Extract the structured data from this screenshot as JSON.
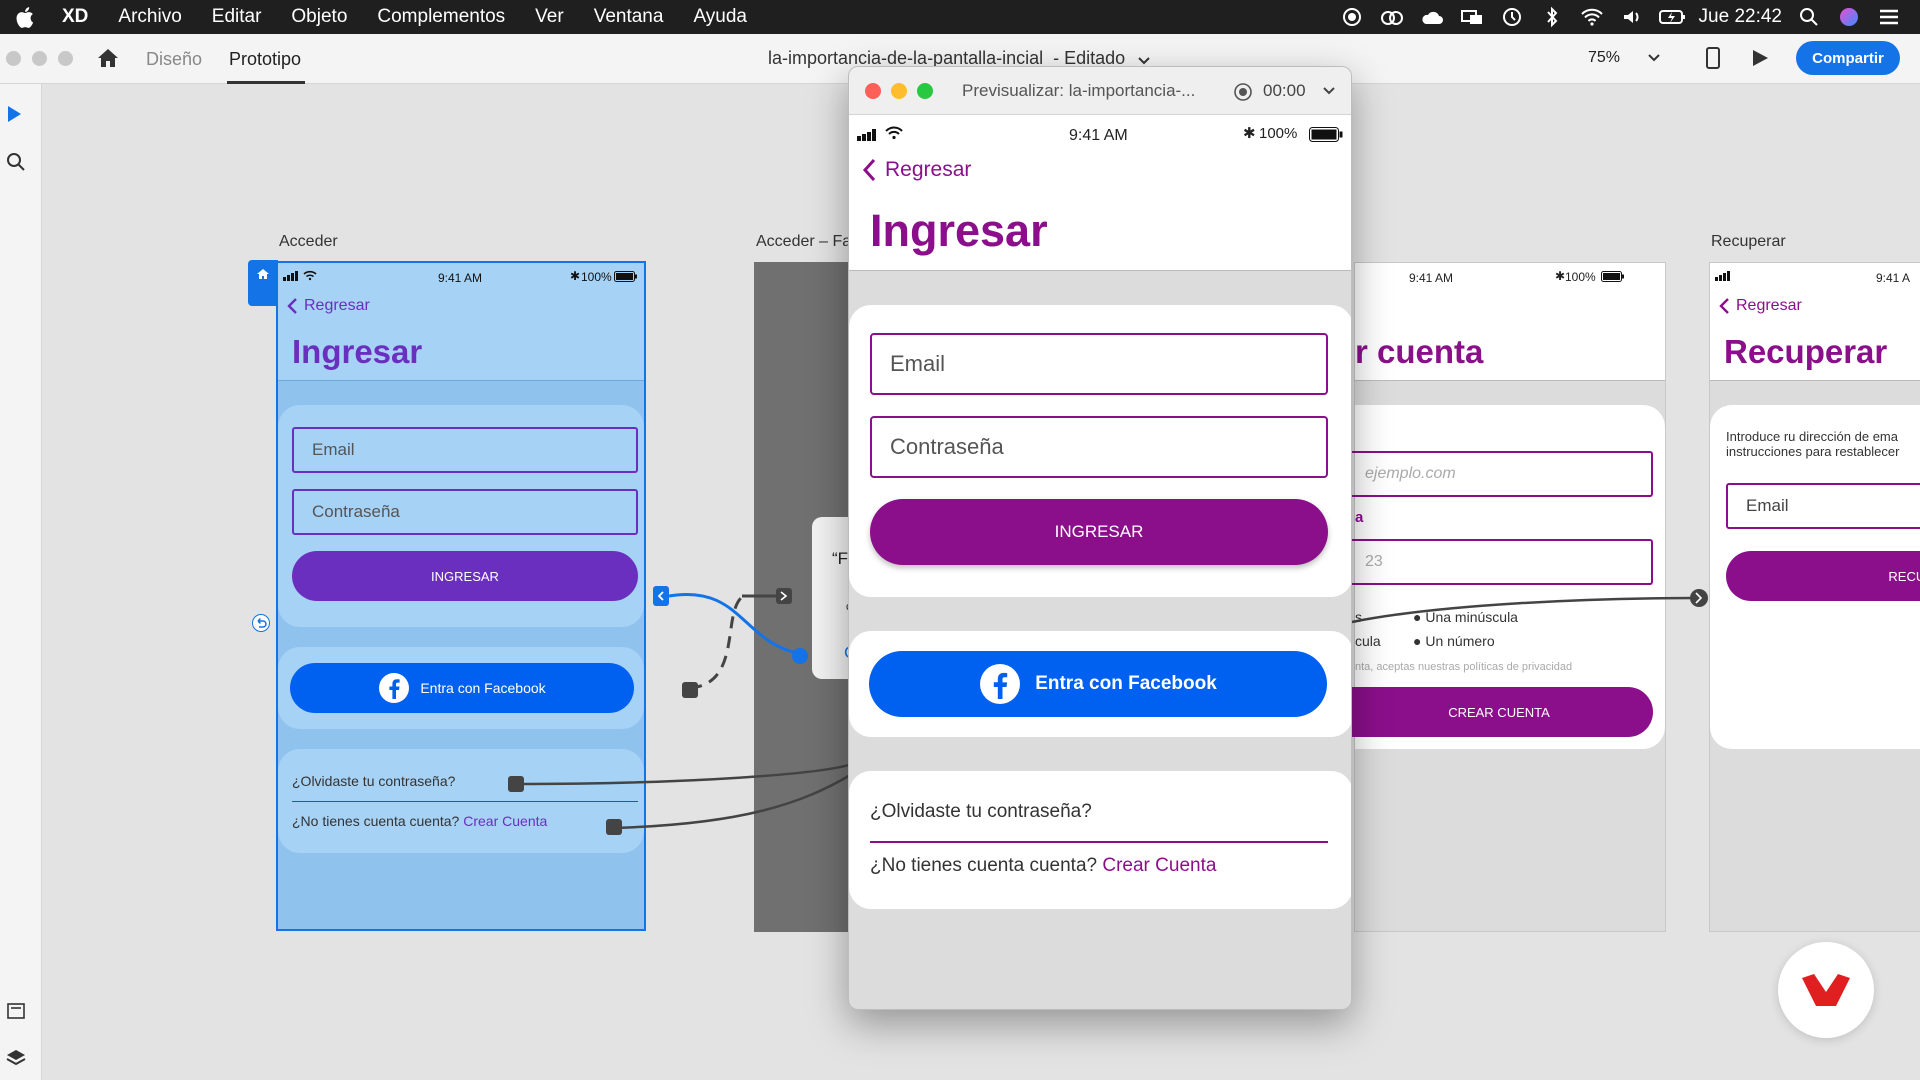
{
  "menubar": {
    "app": "XD",
    "items": [
      "Archivo",
      "Editar",
      "Objeto",
      "Complementos",
      "Ver",
      "Ventana",
      "Ayuda"
    ],
    "clock": "Jue 22:42"
  },
  "toolbar": {
    "tab_design": "Diseño",
    "tab_prototype": "Prototipo",
    "doc_title": "la-importancia-de-la-pantalla-incial",
    "doc_state": "- Editado",
    "zoom": "75%",
    "share": "Compartir"
  },
  "artboards": {
    "acceder": {
      "label": "Acceder",
      "time": "9:41 AM",
      "battery": "100%",
      "back": "Regresar",
      "title": "Ingresar",
      "email": "Email",
      "password": "Contraseña",
      "submit": "INGRESAR",
      "facebook": "Entra con Facebook",
      "forgot": "¿Olvidaste tu contraseña?",
      "noaccount": "¿No tienes cuenta cuenta?",
      "create": "Crear Cuenta"
    },
    "acceder_fb": {
      "label": "Acceder – Fa",
      "dialog_text": "“Fa",
      "dialog_small": "c",
      "dialog_link": "C"
    },
    "crear": {
      "time": "9:41 AM",
      "battery": "100%",
      "title_partial": "r cuenta",
      "email_ph": "ejemplo.com",
      "label_partial": "a",
      "pass_ph": "23",
      "rule1_partial": "s",
      "rule2": "Una minúscula",
      "rule3_partial": "cula",
      "rule4": "Un número",
      "terms": "nta, aceptas nuestras políticas de privacidad",
      "button": "CREAR CUENTA"
    },
    "recuperar": {
      "label": "Recuperar",
      "time": "9:41 A",
      "back": "Regresar",
      "title": "Recuperar",
      "intro1": "Introduce ru dirección de ema",
      "intro2": "instrucciones para restablecer",
      "email": "Email",
      "button": "RECUPER"
    }
  },
  "preview": {
    "title": "Previsualizar: la-importancia-...",
    "timer": "00:00",
    "time": "9:41 AM",
    "battery": "100%",
    "back": "Regresar",
    "heading": "Ingresar",
    "email": "Email",
    "password": "Contraseña",
    "submit": "INGRESAR",
    "facebook": "Entra con Facebook",
    "forgot": "¿Olvidaste tu contraseña?",
    "noaccount": "¿No tienes cuenta cuenta?",
    "create": "Crear Cuenta"
  },
  "colors": {
    "purple": "#8b0f8b",
    "violet": "#6a2fbf",
    "facebook": "#0061f0",
    "xd_blue": "#1473e6"
  }
}
